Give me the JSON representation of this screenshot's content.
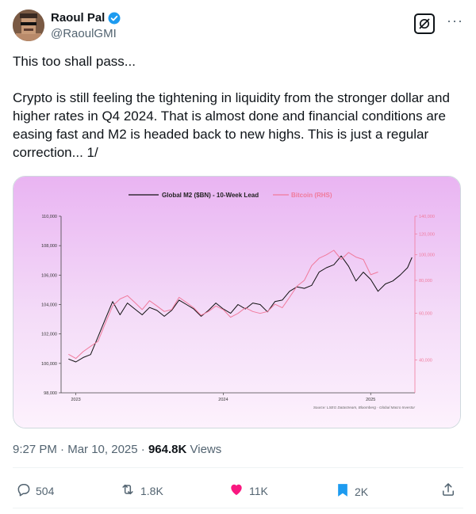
{
  "author": {
    "name": "Raoul Pal",
    "handle": "@RaoulGMI"
  },
  "tweet": {
    "paragraphs": [
      "This too shall pass...",
      "Crypto is still feeling the tightening in liquidity from the stronger dollar and higher rates in Q4 2024. That is almost done and financial conditions are easing fast and M2 is headed back to new highs.  This is just a regular correction... 1/"
    ],
    "time": "9:27 PM",
    "date": "Mar 10, 2025",
    "views_count": "964.8K",
    "views_label": "Views"
  },
  "actions": {
    "replies": "504",
    "reposts": "1.8K",
    "likes": "11K",
    "bookmarks": "2K"
  },
  "icons": [
    "verified-badge-icon",
    "grok-icon",
    "more-icon",
    "reply-icon",
    "repost-icon",
    "like-icon",
    "bookmark-icon",
    "share-icon"
  ],
  "colors": {
    "verified": "#1d9bf0",
    "like": "#f91880",
    "bookmark": "#1d9bf0",
    "m2_line": "#111111",
    "btc_line": "#f07a9c"
  },
  "chart_data": {
    "type": "line",
    "title": "",
    "legend": [
      "Global M2 ($BN) - 10-Week Lead",
      "Bitcoin (RHS)"
    ],
    "legend_position": "top",
    "x_ticks": [
      "2023",
      "2024",
      "2025"
    ],
    "y_left_ticks": [
      "110,000",
      "108,000",
      "106,000",
      "104,000",
      "102,000",
      "100,000",
      "98,000"
    ],
    "y_right_ticks": [
      "140,000",
      "120,000",
      "100,000",
      "80,000",
      "60,000",
      "40,000"
    ],
    "y_left_range": [
      98000,
      110000
    ],
    "y_right_range": [
      30000,
      140000
    ],
    "y_right_scale": "log",
    "source": "Source: LSEG Datastream, Bloomberg - Global Macro Investor",
    "series": [
      {
        "name": "Global M2 ($BN) - 10-Week Lead",
        "axis": "left",
        "x": [
          2022.95,
          2023.0,
          2023.05,
          2023.1,
          2023.15,
          2023.2,
          2023.25,
          2023.3,
          2023.35,
          2023.4,
          2023.45,
          2023.5,
          2023.55,
          2023.6,
          2023.65,
          2023.7,
          2023.75,
          2023.8,
          2023.85,
          2023.9,
          2023.95,
          2024.0,
          2024.05,
          2024.1,
          2024.15,
          2024.2,
          2024.25,
          2024.3,
          2024.35,
          2024.4,
          2024.45,
          2024.5,
          2024.55,
          2024.6,
          2024.65,
          2024.7,
          2024.75,
          2024.8,
          2024.85,
          2024.9,
          2024.95,
          2025.0,
          2025.05,
          2025.1,
          2025.15,
          2025.2,
          2025.25,
          2025.28
        ],
        "values": [
          100300,
          100100,
          100400,
          100600,
          101800,
          103000,
          104200,
          103300,
          104100,
          103700,
          103300,
          103800,
          103600,
          103200,
          103600,
          104300,
          104000,
          103700,
          103200,
          103600,
          104100,
          103700,
          103400,
          104000,
          103700,
          104100,
          104000,
          103500,
          104200,
          104300,
          104900,
          105200,
          105100,
          105300,
          106200,
          106500,
          106700,
          107300,
          106600,
          105600,
          106200,
          105700,
          104900,
          105400,
          105600,
          106000,
          106500,
          107200
        ]
      },
      {
        "name": "Bitcoin (RHS)",
        "axis": "right",
        "x": [
          2022.95,
          2023.0,
          2023.05,
          2023.1,
          2023.15,
          2023.2,
          2023.25,
          2023.3,
          2023.35,
          2023.4,
          2023.45,
          2023.5,
          2023.55,
          2023.6,
          2023.65,
          2023.7,
          2023.75,
          2023.8,
          2023.85,
          2023.9,
          2023.95,
          2024.0,
          2024.05,
          2024.1,
          2024.15,
          2024.2,
          2024.25,
          2024.3,
          2024.35,
          2024.4,
          2024.45,
          2024.5,
          2024.55,
          2024.6,
          2024.65,
          2024.7,
          2024.75,
          2024.8,
          2024.85,
          2024.9,
          2024.95,
          2025.0,
          2025.05
        ],
        "values": [
          42000,
          40500,
          43000,
          45000,
          47000,
          55000,
          64000,
          68000,
          70000,
          66000,
          62000,
          67000,
          64000,
          61000,
          62000,
          69000,
          66000,
          63000,
          59000,
          61000,
          64000,
          62000,
          58000,
          60000,
          63000,
          61000,
          60000,
          61000,
          65000,
          63000,
          69000,
          76000,
          80000,
          91000,
          97000,
          100000,
          104000,
          96000,
          102000,
          98000,
          96000,
          84000,
          86000
        ]
      }
    ]
  }
}
